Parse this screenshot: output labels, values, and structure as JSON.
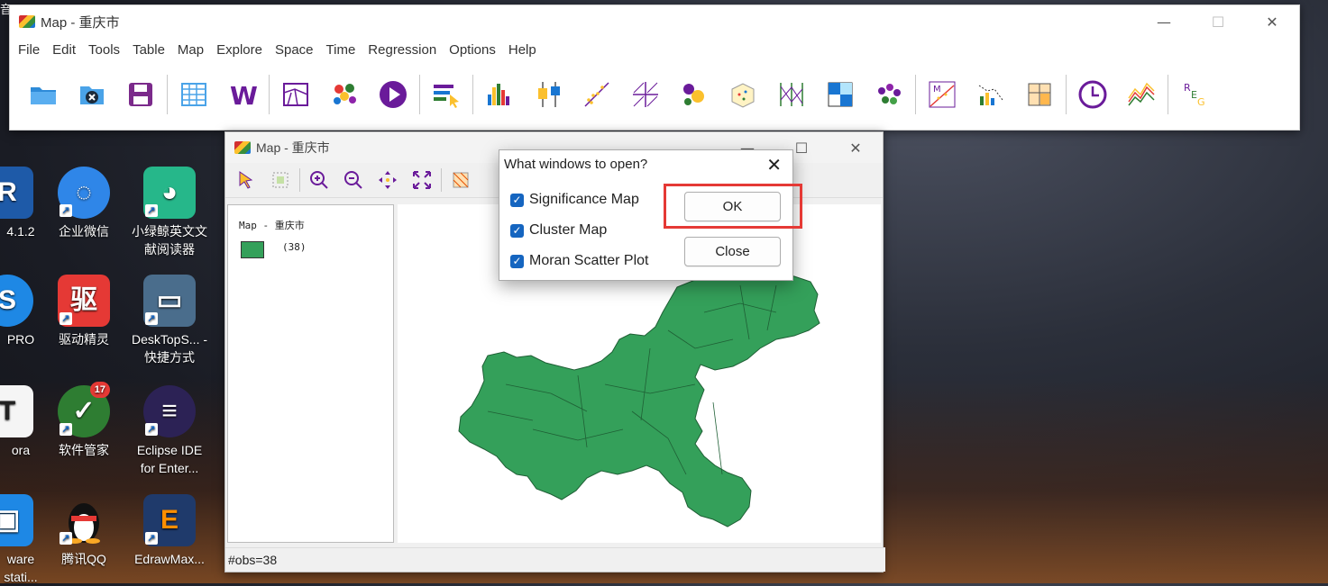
{
  "main_window": {
    "title": "Map - 重庆市",
    "menu": [
      "File",
      "Edit",
      "Tools",
      "Table",
      "Map",
      "Explore",
      "Space",
      "Time",
      "Regression",
      "Options",
      "Help"
    ],
    "toolbar_icons": [
      "open-folder-icon",
      "close-file-icon",
      "save-icon",
      "table-icon",
      "weights-icon",
      "map-icon",
      "cluster-map-icon",
      "play-icon",
      "category-icon",
      "histogram-icon",
      "boxplot-icon",
      "scatter-plot-icon",
      "scatter-matrix-icon",
      "bubble-chart-icon",
      "3d-plot-icon",
      "parallel-coordinate-icon",
      "conditional-map-icon",
      "cluster-icon",
      "moran-scatter-icon",
      "lisa-icon",
      "cartogram-icon",
      "time-icon",
      "line-chart-icon",
      "regression-icon"
    ]
  },
  "map_window": {
    "title": "Map - 重庆市",
    "legend_title": "Map - 重庆市",
    "legend_count": "(38)",
    "status": "#obs=38",
    "fill_color": "#34a05a"
  },
  "dialog": {
    "title": "What windows to open?",
    "options": [
      {
        "label": "Significance Map",
        "checked": true
      },
      {
        "label": "Cluster Map",
        "checked": true
      },
      {
        "label": "Moran Scatter Plot",
        "checked": true
      }
    ],
    "ok_label": "OK",
    "close_label": "Close"
  },
  "desktop": {
    "top_left_text": "音",
    "icons": [
      {
        "label": "4.1.2"
      },
      {
        "label": "企业微信"
      },
      {
        "label": "小绿鲸英文文献阅读器"
      },
      {
        "label": "PRO"
      },
      {
        "label": "驱动精灵"
      },
      {
        "label": "DeskTopS... - 快捷方式"
      },
      {
        "label": "ora"
      },
      {
        "label": "软件管家",
        "badge": "17"
      },
      {
        "label": "Eclipse IDE for Enter..."
      },
      {
        "label": "ware stati..."
      },
      {
        "label": "腾讯QQ"
      },
      {
        "label": "EdrawMax..."
      }
    ]
  }
}
